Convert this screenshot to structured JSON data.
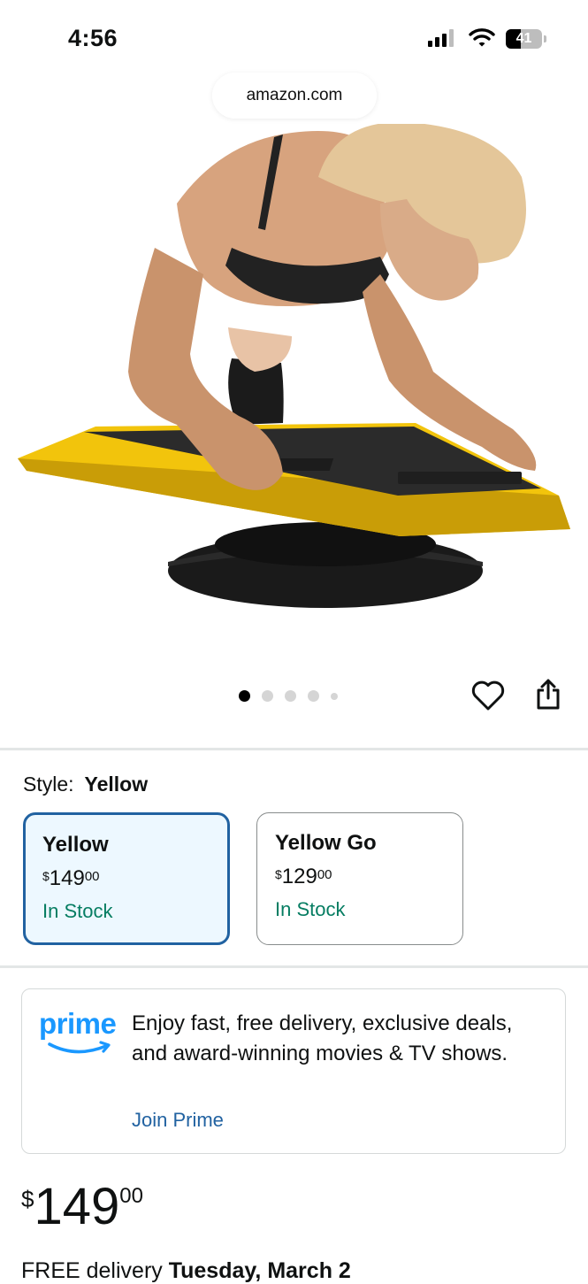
{
  "status_bar": {
    "time": "4:56",
    "battery": "41"
  },
  "browser": {
    "url": "amazon.com"
  },
  "carousel": {
    "total": 5,
    "active_index": 0
  },
  "style": {
    "label": "Style:",
    "selected": "Yellow",
    "options": [
      {
        "name": "Yellow",
        "currency": "$",
        "whole": "149",
        "fraction": "00",
        "stock": "In Stock"
      },
      {
        "name": "Yellow Go",
        "currency": "$",
        "whole": "129",
        "fraction": "00",
        "stock": "In Stock"
      }
    ]
  },
  "prime": {
    "logo_text": "prime",
    "message": "Enjoy fast, free delivery, exclusive deals, and award-winning movies & TV shows.",
    "cta": "Join Prime"
  },
  "price": {
    "currency": "$",
    "whole": "149",
    "fraction": "00"
  },
  "delivery": {
    "prefix": "FREE delivery",
    "date": "Tuesday, March 2"
  },
  "colors": {
    "accent_blue": "#2162a1",
    "stock_green": "#067d62",
    "selected_bg": "#edf8ff",
    "board_yellow": "#f2c40c"
  },
  "icons": [
    "signal-icon",
    "wifi-icon",
    "battery-icon",
    "heart-icon",
    "share-icon",
    "prime-smile-icon"
  ]
}
